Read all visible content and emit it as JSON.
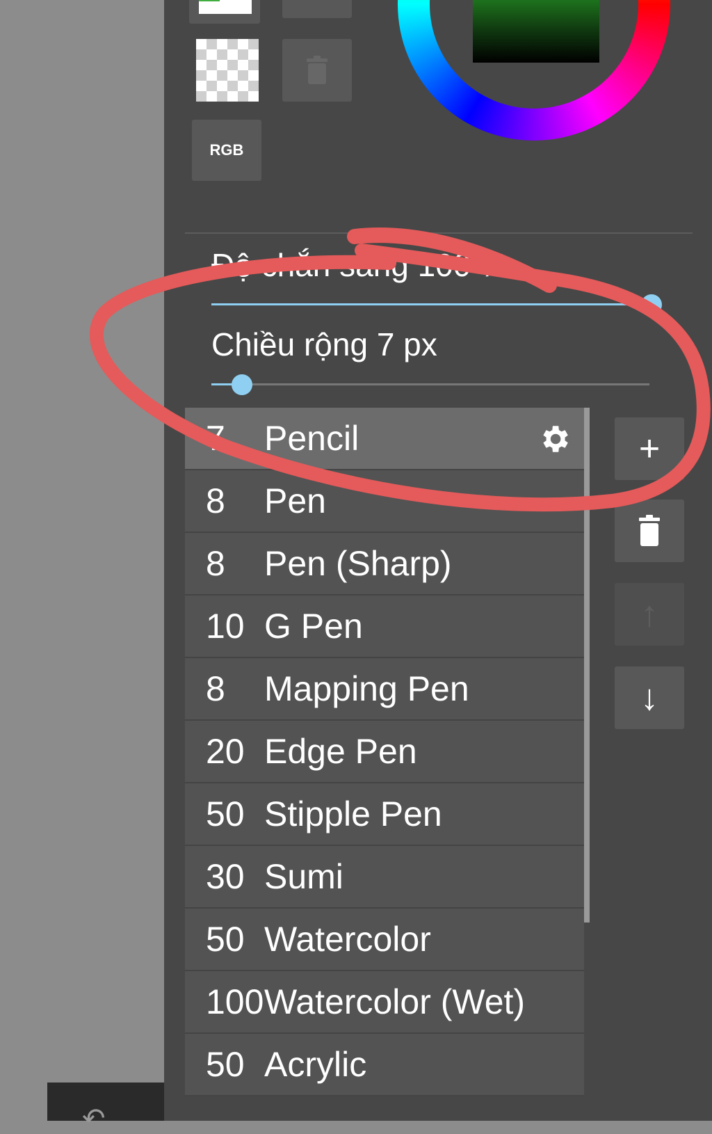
{
  "tools": {
    "color_mode_label": "RGB"
  },
  "sliders": {
    "opacity": {
      "label": "Độ chắn sáng",
      "value": 100,
      "unit": "%",
      "display": "Độ chắn sáng  100 %"
    },
    "width": {
      "label": "Chiều rộng",
      "value": 7,
      "unit": "px",
      "display": "Chiều rộng  7  px"
    }
  },
  "brushes": [
    {
      "size": "7",
      "name": "Pencil",
      "selected": true
    },
    {
      "size": "8",
      "name": "Pen",
      "selected": false
    },
    {
      "size": "8",
      "name": "Pen (Sharp)",
      "selected": false
    },
    {
      "size": "10",
      "name": "G Pen",
      "selected": false
    },
    {
      "size": "8",
      "name": "Mapping Pen",
      "selected": false
    },
    {
      "size": "20",
      "name": "Edge Pen",
      "selected": false
    },
    {
      "size": "50",
      "name": "Stipple Pen",
      "selected": false
    },
    {
      "size": "30",
      "name": "Sumi",
      "selected": false
    },
    {
      "size": "50",
      "name": "Watercolor",
      "selected": false
    },
    {
      "size": "100",
      "name": "Watercolor (Wet)",
      "selected": false
    },
    {
      "size": "50",
      "name": "Acrylic",
      "selected": false
    }
  ],
  "side_buttons": {
    "add": "+",
    "move_up": "↑",
    "move_down": "↓"
  },
  "colors": {
    "panel_bg": "#474747",
    "slider_accent": "#8fd0f2",
    "annotation": "#e55a5a",
    "selected_row": "#6c6c6c"
  },
  "icons": {
    "settings": "gear-icon",
    "delete": "trash-icon",
    "undo": "undo-icon"
  }
}
